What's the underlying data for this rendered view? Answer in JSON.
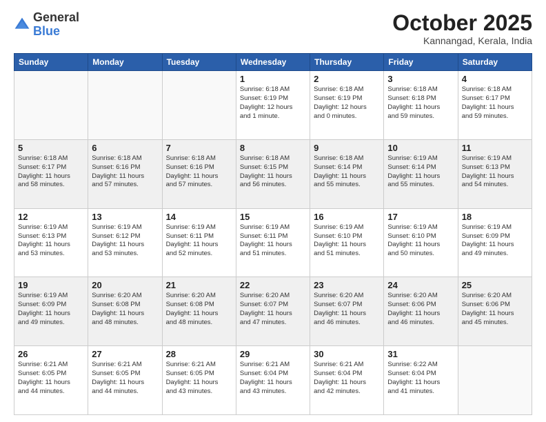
{
  "header": {
    "logo_general": "General",
    "logo_blue": "Blue",
    "month_title": "October 2025",
    "location": "Kannangad, Kerala, India"
  },
  "weekdays": [
    "Sunday",
    "Monday",
    "Tuesday",
    "Wednesday",
    "Thursday",
    "Friday",
    "Saturday"
  ],
  "rows": [
    {
      "shade": "white",
      "cells": [
        {
          "day": "",
          "info": ""
        },
        {
          "day": "",
          "info": ""
        },
        {
          "day": "",
          "info": ""
        },
        {
          "day": "1",
          "info": "Sunrise: 6:18 AM\nSunset: 6:19 PM\nDaylight: 12 hours\nand 1 minute."
        },
        {
          "day": "2",
          "info": "Sunrise: 6:18 AM\nSunset: 6:19 PM\nDaylight: 12 hours\nand 0 minutes."
        },
        {
          "day": "3",
          "info": "Sunrise: 6:18 AM\nSunset: 6:18 PM\nDaylight: 11 hours\nand 59 minutes."
        },
        {
          "day": "4",
          "info": "Sunrise: 6:18 AM\nSunset: 6:17 PM\nDaylight: 11 hours\nand 59 minutes."
        }
      ]
    },
    {
      "shade": "shaded",
      "cells": [
        {
          "day": "5",
          "info": "Sunrise: 6:18 AM\nSunset: 6:17 PM\nDaylight: 11 hours\nand 58 minutes."
        },
        {
          "day": "6",
          "info": "Sunrise: 6:18 AM\nSunset: 6:16 PM\nDaylight: 11 hours\nand 57 minutes."
        },
        {
          "day": "7",
          "info": "Sunrise: 6:18 AM\nSunset: 6:16 PM\nDaylight: 11 hours\nand 57 minutes."
        },
        {
          "day": "8",
          "info": "Sunrise: 6:18 AM\nSunset: 6:15 PM\nDaylight: 11 hours\nand 56 minutes."
        },
        {
          "day": "9",
          "info": "Sunrise: 6:18 AM\nSunset: 6:14 PM\nDaylight: 11 hours\nand 55 minutes."
        },
        {
          "day": "10",
          "info": "Sunrise: 6:19 AM\nSunset: 6:14 PM\nDaylight: 11 hours\nand 55 minutes."
        },
        {
          "day": "11",
          "info": "Sunrise: 6:19 AM\nSunset: 6:13 PM\nDaylight: 11 hours\nand 54 minutes."
        }
      ]
    },
    {
      "shade": "white",
      "cells": [
        {
          "day": "12",
          "info": "Sunrise: 6:19 AM\nSunset: 6:13 PM\nDaylight: 11 hours\nand 53 minutes."
        },
        {
          "day": "13",
          "info": "Sunrise: 6:19 AM\nSunset: 6:12 PM\nDaylight: 11 hours\nand 53 minutes."
        },
        {
          "day": "14",
          "info": "Sunrise: 6:19 AM\nSunset: 6:11 PM\nDaylight: 11 hours\nand 52 minutes."
        },
        {
          "day": "15",
          "info": "Sunrise: 6:19 AM\nSunset: 6:11 PM\nDaylight: 11 hours\nand 51 minutes."
        },
        {
          "day": "16",
          "info": "Sunrise: 6:19 AM\nSunset: 6:10 PM\nDaylight: 11 hours\nand 51 minutes."
        },
        {
          "day": "17",
          "info": "Sunrise: 6:19 AM\nSunset: 6:10 PM\nDaylight: 11 hours\nand 50 minutes."
        },
        {
          "day": "18",
          "info": "Sunrise: 6:19 AM\nSunset: 6:09 PM\nDaylight: 11 hours\nand 49 minutes."
        }
      ]
    },
    {
      "shade": "shaded",
      "cells": [
        {
          "day": "19",
          "info": "Sunrise: 6:19 AM\nSunset: 6:09 PM\nDaylight: 11 hours\nand 49 minutes."
        },
        {
          "day": "20",
          "info": "Sunrise: 6:20 AM\nSunset: 6:08 PM\nDaylight: 11 hours\nand 48 minutes."
        },
        {
          "day": "21",
          "info": "Sunrise: 6:20 AM\nSunset: 6:08 PM\nDaylight: 11 hours\nand 48 minutes."
        },
        {
          "day": "22",
          "info": "Sunrise: 6:20 AM\nSunset: 6:07 PM\nDaylight: 11 hours\nand 47 minutes."
        },
        {
          "day": "23",
          "info": "Sunrise: 6:20 AM\nSunset: 6:07 PM\nDaylight: 11 hours\nand 46 minutes."
        },
        {
          "day": "24",
          "info": "Sunrise: 6:20 AM\nSunset: 6:06 PM\nDaylight: 11 hours\nand 46 minutes."
        },
        {
          "day": "25",
          "info": "Sunrise: 6:20 AM\nSunset: 6:06 PM\nDaylight: 11 hours\nand 45 minutes."
        }
      ]
    },
    {
      "shade": "white",
      "cells": [
        {
          "day": "26",
          "info": "Sunrise: 6:21 AM\nSunset: 6:05 PM\nDaylight: 11 hours\nand 44 minutes."
        },
        {
          "day": "27",
          "info": "Sunrise: 6:21 AM\nSunset: 6:05 PM\nDaylight: 11 hours\nand 44 minutes."
        },
        {
          "day": "28",
          "info": "Sunrise: 6:21 AM\nSunset: 6:05 PM\nDaylight: 11 hours\nand 43 minutes."
        },
        {
          "day": "29",
          "info": "Sunrise: 6:21 AM\nSunset: 6:04 PM\nDaylight: 11 hours\nand 43 minutes."
        },
        {
          "day": "30",
          "info": "Sunrise: 6:21 AM\nSunset: 6:04 PM\nDaylight: 11 hours\nand 42 minutes."
        },
        {
          "day": "31",
          "info": "Sunrise: 6:22 AM\nSunset: 6:04 PM\nDaylight: 11 hours\nand 41 minutes."
        },
        {
          "day": "",
          "info": ""
        }
      ]
    }
  ]
}
